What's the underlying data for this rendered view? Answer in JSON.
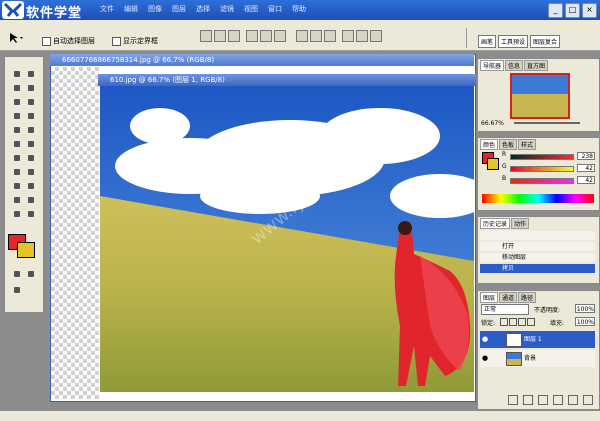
{
  "brand": {
    "name": "软件学堂"
  },
  "menu": [
    "文件",
    "编辑",
    "图像",
    "图层",
    "选择",
    "滤镜",
    "视图",
    "窗口",
    "帮助"
  ],
  "options_bar": {
    "auto_select_layer": "自动选择图层",
    "show_bounds": "显示定界框"
  },
  "right_tabs": [
    "画笔",
    "工具预设",
    "图层复合"
  ],
  "doc_back": {
    "title": "66607766866758314.jpg @ 66.7% (RGB/8)"
  },
  "doc_front": {
    "title": "610.jpg @ 66.7% (图层 1, RGB/8)"
  },
  "navigator": {
    "tabs": [
      "导航器",
      "信息",
      "直方图"
    ],
    "zoom": "66.67%"
  },
  "color_panel": {
    "tabs": [
      "颜色",
      "色板",
      "样式"
    ],
    "channels": [
      {
        "label": "R",
        "value": "238"
      },
      {
        "label": "G",
        "value": "42"
      },
      {
        "label": "B",
        "value": "42"
      }
    ],
    "colors": {
      "foreground": "#e3262b",
      "background": "#e3c52a"
    }
  },
  "history": {
    "tabs": [
      "历史记录",
      "动作"
    ],
    "items": [
      "打开",
      "移动图层",
      "拷贝"
    ]
  },
  "layers": {
    "tabs": [
      "图层",
      "通道",
      "路径"
    ],
    "blend_mode": "正常",
    "opacity_label": "不透明度:",
    "opacity": "100%",
    "lock_label": "锁定:",
    "fill_label": "填充:",
    "fill": "100%",
    "items": [
      {
        "name": "图层 1",
        "selected": true
      },
      {
        "name": "背景",
        "selected": false
      }
    ]
  },
  "watermark": "www.rjxt.com"
}
